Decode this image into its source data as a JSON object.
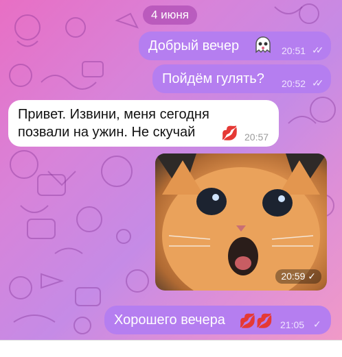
{
  "date_separator": "4 июня",
  "messages": [
    {
      "text": "Добрый вечер",
      "time": "20:51",
      "status": "read",
      "emoji": "ghost-sticker"
    },
    {
      "text": "Пойдём гулять?",
      "time": "20:52",
      "status": "read"
    },
    {
      "text_line1": "Привет. Извини, меня сегодня",
      "text_line2": "позвали на ужин. Не скучай",
      "time": "20:57",
      "emoji": "💋"
    },
    {
      "type": "photo",
      "time": "20:59",
      "status": "sent"
    },
    {
      "text": "Хорошего вечера",
      "time": "21:05",
      "status": "sent",
      "emoji": "💋💋"
    }
  ],
  "colors": {
    "outgoing_bubble": "#b57ef0",
    "incoming_bubble": "#ffffff",
    "background_start": "#e86fc4",
    "background_end": "#c58be6"
  },
  "icons": [
    "double-check-icon",
    "check-icon",
    "ghost-sticker-icon",
    "kiss-emoji",
    "cat-photo"
  ]
}
